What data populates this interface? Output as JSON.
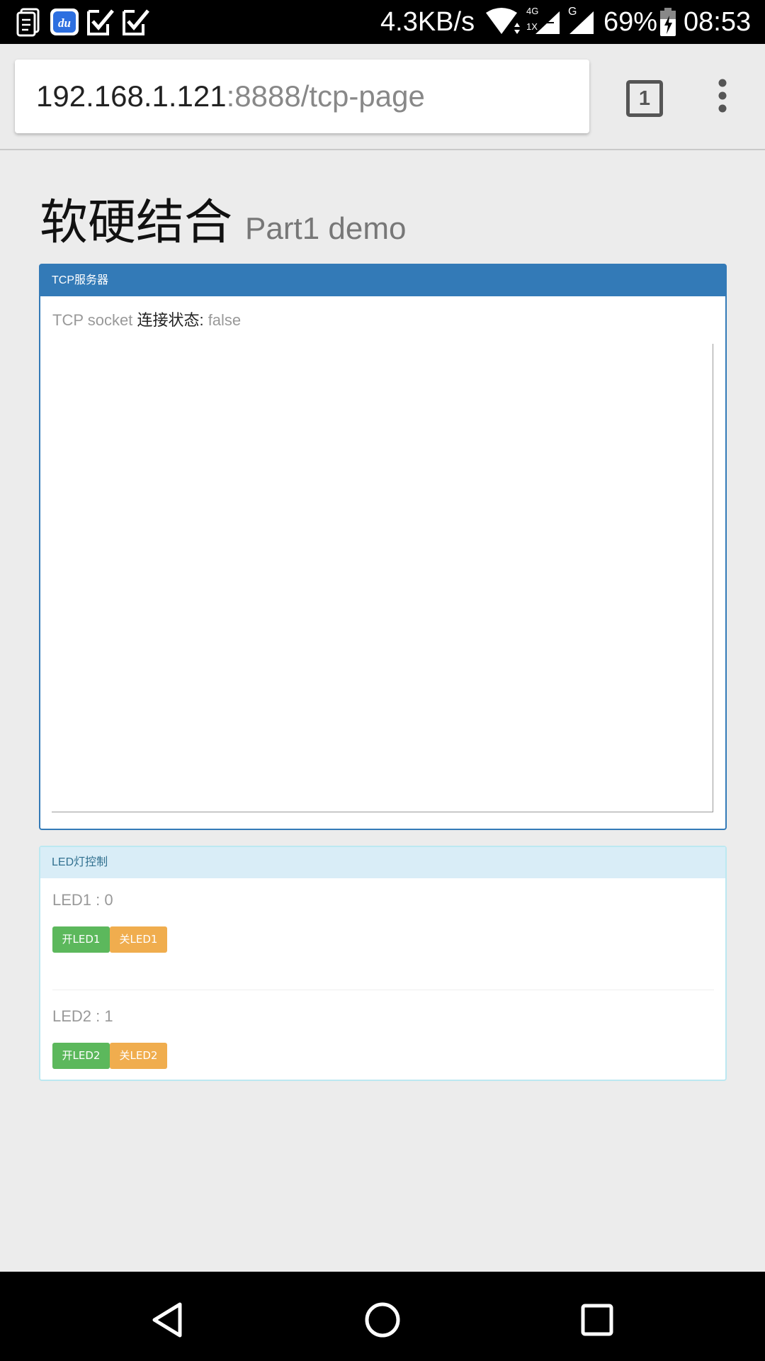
{
  "status_bar": {
    "net_speed": "4.3KB/s",
    "network_label_top": "4G",
    "network_label_bottom": "1X",
    "g_label": "G",
    "battery": "69%",
    "time": "08:53",
    "icons": [
      "clipboard-icon",
      "baidu-du-icon",
      "check-icon",
      "check-icon",
      "wifi-icon",
      "signal-icon",
      "battery-charging-icon"
    ]
  },
  "browser": {
    "url_host": "192.168.1.121",
    "url_rest": ":8888/tcp-page",
    "tab_count": "1"
  },
  "page": {
    "title": "软硬结合",
    "subtitle": "Part1 demo"
  },
  "tcp_panel": {
    "heading": "TCP服务器",
    "status_prefix": "TCP socket",
    "status_label": "连接状态:",
    "status_value": "false",
    "color": "#337ab7"
  },
  "led_panel": {
    "heading": "LED灯控制",
    "color": "#d9edf7",
    "leds": [
      {
        "label": "LED1 : 0",
        "on_label": "开LED1",
        "off_label": "关LED1"
      },
      {
        "label": "LED2 : 1",
        "on_label": "开LED2",
        "off_label": "关LED2"
      }
    ]
  },
  "colors": {
    "on_button": "#5cb85c",
    "off_button": "#f0ad4e"
  }
}
